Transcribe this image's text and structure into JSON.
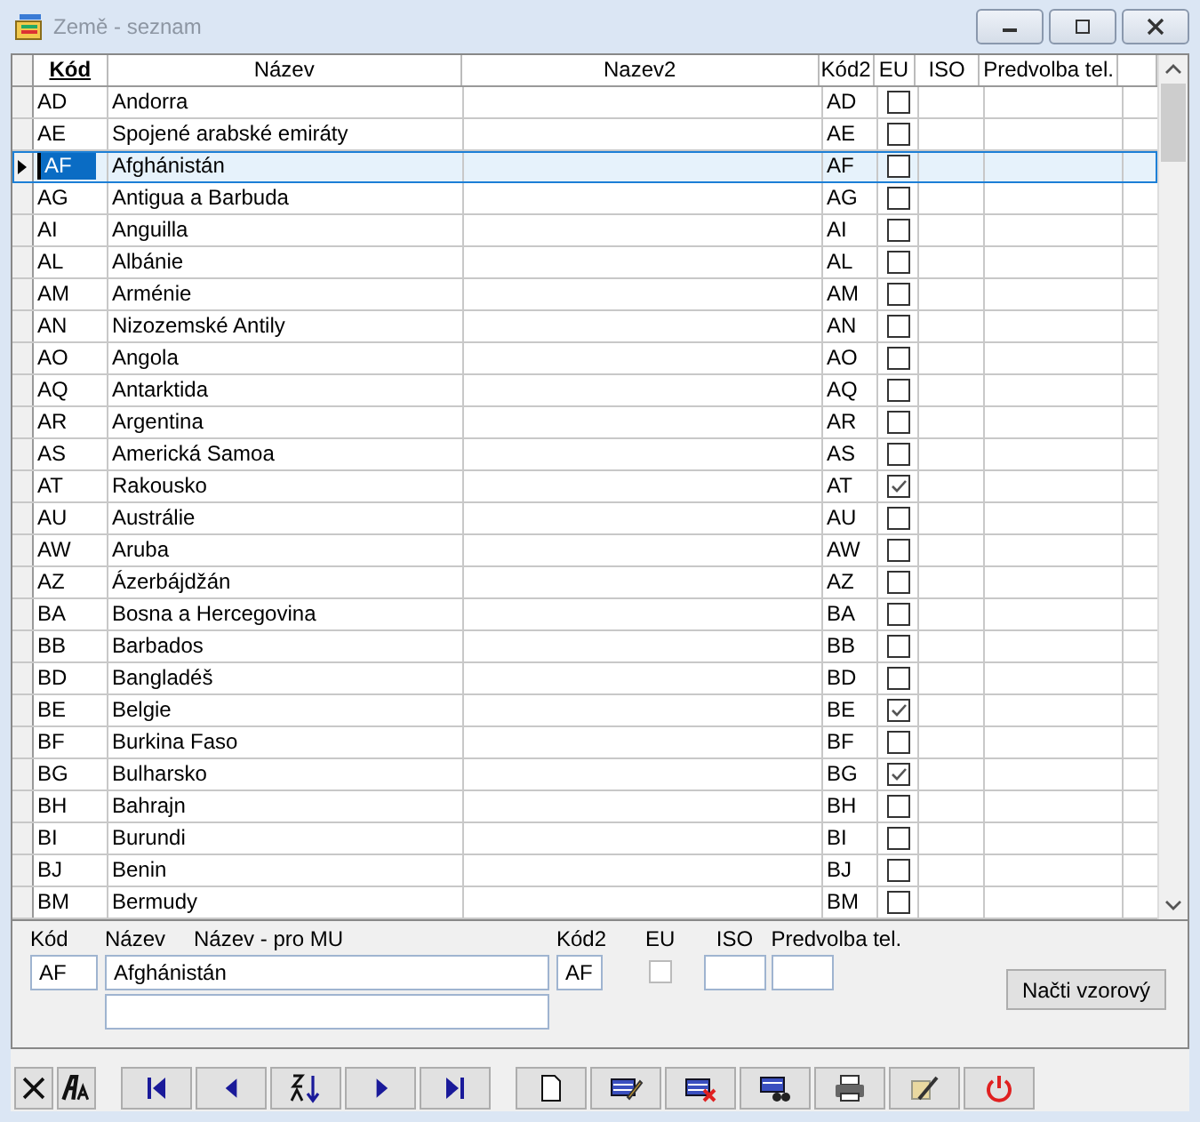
{
  "window": {
    "title": "Země - seznam"
  },
  "table": {
    "columns": [
      {
        "label": "Kód",
        "sorted": true
      },
      {
        "label": "Název",
        "sorted": false
      },
      {
        "label": "Nazev2",
        "sorted": false
      },
      {
        "label": "Kód2",
        "sorted": false
      },
      {
        "label": "EU",
        "sorted": false
      },
      {
        "label": "ISO",
        "sorted": false
      },
      {
        "label": "Predvolba tel.",
        "sorted": false
      }
    ],
    "rows": [
      {
        "code": "AD",
        "name": "Andorra",
        "code2": "AD",
        "eu": false,
        "selected": false
      },
      {
        "code": "AE",
        "name": "Spojené arabské emiráty",
        "code2": "AE",
        "eu": false,
        "selected": false
      },
      {
        "code": "AF",
        "name": "Afghánistán",
        "code2": "AF",
        "eu": false,
        "selected": true
      },
      {
        "code": "AG",
        "name": "Antigua a Barbuda",
        "code2": "AG",
        "eu": false,
        "selected": false
      },
      {
        "code": "AI",
        "name": "Anguilla",
        "code2": "AI",
        "eu": false,
        "selected": false
      },
      {
        "code": "AL",
        "name": "Albánie",
        "code2": "AL",
        "eu": false,
        "selected": false
      },
      {
        "code": "AM",
        "name": "Arménie",
        "code2": "AM",
        "eu": false,
        "selected": false
      },
      {
        "code": "AN",
        "name": "Nizozemské Antily",
        "code2": "AN",
        "eu": false,
        "selected": false
      },
      {
        "code": "AO",
        "name": "Angola",
        "code2": "AO",
        "eu": false,
        "selected": false
      },
      {
        "code": "AQ",
        "name": "Antarktida",
        "code2": "AQ",
        "eu": false,
        "selected": false
      },
      {
        "code": "AR",
        "name": "Argentina",
        "code2": "AR",
        "eu": false,
        "selected": false
      },
      {
        "code": "AS",
        "name": "Americká Samoa",
        "code2": "AS",
        "eu": false,
        "selected": false
      },
      {
        "code": "AT",
        "name": "Rakousko",
        "code2": "AT",
        "eu": true,
        "selected": false
      },
      {
        "code": "AU",
        "name": "Austrálie",
        "code2": "AU",
        "eu": false,
        "selected": false
      },
      {
        "code": "AW",
        "name": "Aruba",
        "code2": "AW",
        "eu": false,
        "selected": false
      },
      {
        "code": "AZ",
        "name": "Ázerbájdžán",
        "code2": "AZ",
        "eu": false,
        "selected": false
      },
      {
        "code": "BA",
        "name": "Bosna a Hercegovina",
        "code2": "BA",
        "eu": false,
        "selected": false
      },
      {
        "code": "BB",
        "name": "Barbados",
        "code2": "BB",
        "eu": false,
        "selected": false
      },
      {
        "code": "BD",
        "name": "Bangladéš",
        "code2": "BD",
        "eu": false,
        "selected": false
      },
      {
        "code": "BE",
        "name": "Belgie",
        "code2": "BE",
        "eu": true,
        "selected": false
      },
      {
        "code": "BF",
        "name": "Burkina Faso",
        "code2": "BF",
        "eu": false,
        "selected": false
      },
      {
        "code": "BG",
        "name": "Bulharsko",
        "code2": "BG",
        "eu": true,
        "selected": false
      },
      {
        "code": "BH",
        "name": "Bahrajn",
        "code2": "BH",
        "eu": false,
        "selected": false
      },
      {
        "code": "BI",
        "name": "Burundi",
        "code2": "BI",
        "eu": false,
        "selected": false
      },
      {
        "code": "BJ",
        "name": "Benin",
        "code2": "BJ",
        "eu": false,
        "selected": false
      },
      {
        "code": "BM",
        "name": "Bermudy",
        "code2": "BM",
        "eu": false,
        "selected": false
      }
    ]
  },
  "form": {
    "code_label": "Kód",
    "code": "AF",
    "name_label": "Název",
    "name_mu_label": "Název - pro MU",
    "name": "Afghánistán",
    "code2_label": "Kód2",
    "code2": "AF",
    "eu_label": "EU",
    "eu": false,
    "iso_label": "ISO",
    "phone_label": "Predvolba tel.",
    "load_button": "Načti vzorový"
  },
  "toolbar": [
    {
      "kind": "close"
    },
    {
      "kind": "font"
    },
    {
      "kind": "first"
    },
    {
      "kind": "prev"
    },
    {
      "kind": "sort"
    },
    {
      "kind": "next"
    },
    {
      "kind": "last"
    },
    {
      "kind": "new"
    },
    {
      "kind": "edit"
    },
    {
      "kind": "delete"
    },
    {
      "kind": "find"
    },
    {
      "kind": "print"
    },
    {
      "kind": "tools"
    },
    {
      "kind": "power"
    }
  ]
}
